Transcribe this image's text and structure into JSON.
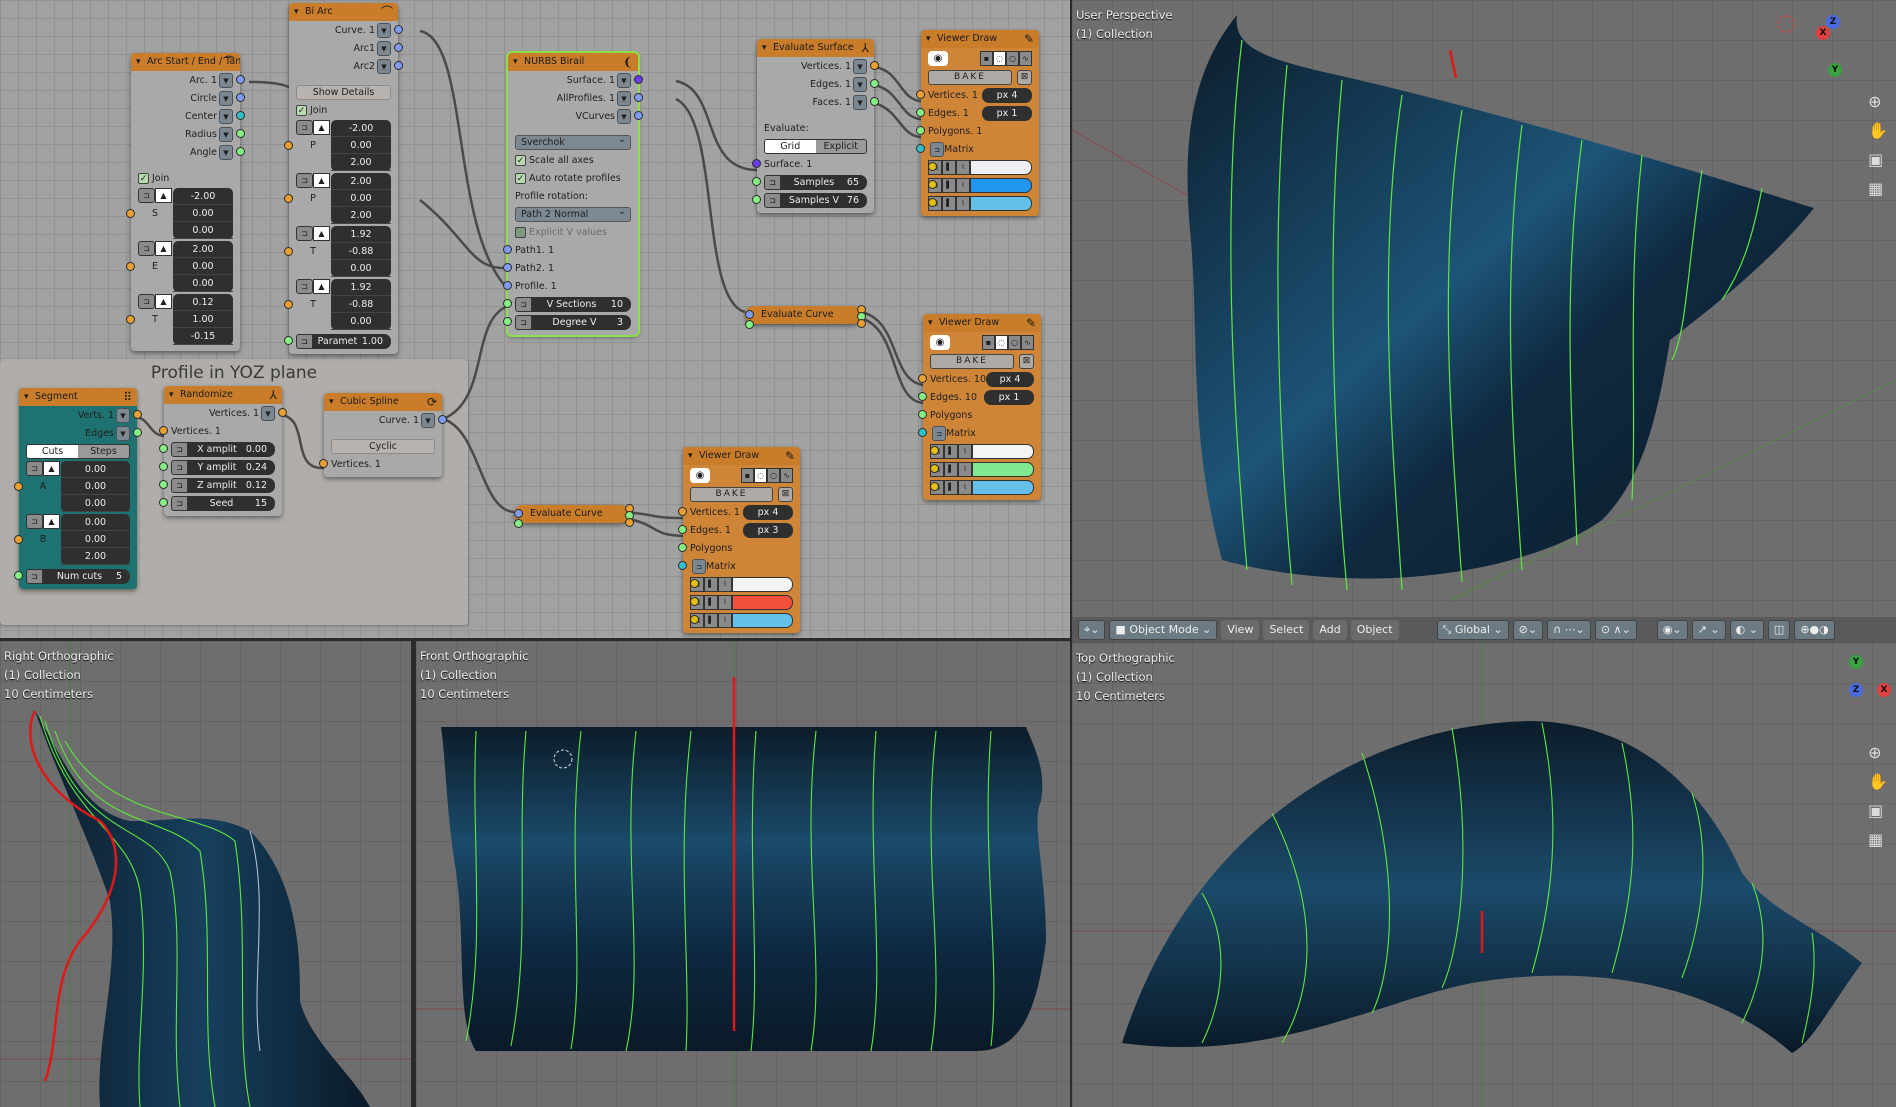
{
  "socket_colors": {
    "vertices": "#e8a030",
    "number": "#86f086",
    "curve": "#7f9cf0",
    "matrix": "#30c0c8",
    "surface": "#6a3cf0",
    "color": "#e0c010"
  },
  "node_editor": {
    "frame_label": "Profile in YOZ plane",
    "nodes": [
      {
        "id": "arc",
        "title": "Arc Start / End / Tan.",
        "icon": "arc-icon",
        "style": "",
        "rows": [
          {
            "t": "out",
            "label": "Arc. 1",
            "sock": "curve"
          },
          {
            "t": "out",
            "label": "Circle",
            "sock": "curve"
          },
          {
            "t": "out",
            "label": "Center",
            "sock": "matrix"
          },
          {
            "t": "out",
            "label": "Radius",
            "sock": "number"
          },
          {
            "t": "out",
            "label": "Angle",
            "sock": "number"
          },
          {
            "t": "gap"
          },
          {
            "t": "check",
            "label": "Join",
            "checked": true
          },
          {
            "t": "vec",
            "label": "S",
            "values": [
              "-2.00",
              "0.00",
              "0.00"
            ]
          },
          {
            "t": "vec",
            "label": "E",
            "values": [
              "2.00",
              "0.00",
              "0.00"
            ]
          },
          {
            "t": "vec",
            "label": "T",
            "values": [
              "0.12",
              "1.00",
              "-0.15"
            ]
          }
        ]
      },
      {
        "id": "biarc",
        "title": "Bi Arc",
        "icon": "arc-icon",
        "style": "",
        "rows": [
          {
            "t": "out",
            "label": "Curve. 1",
            "sock": "curve"
          },
          {
            "t": "out",
            "label": "Arc1",
            "sock": "curve"
          },
          {
            "t": "out",
            "label": "Arc2",
            "sock": "curve"
          },
          {
            "t": "gap"
          },
          {
            "t": "button",
            "label": "Show Details"
          },
          {
            "t": "check",
            "label": "Join",
            "checked": true
          },
          {
            "t": "vec",
            "label": "P",
            "values": [
              "-2.00",
              "0.00",
              "2.00"
            ]
          },
          {
            "t": "vec",
            "label": "P",
            "values": [
              "2.00",
              "0.00",
              "2.00"
            ]
          },
          {
            "t": "vec",
            "label": "T",
            "values": [
              "1.92",
              "-0.88",
              "0.00"
            ]
          },
          {
            "t": "vec",
            "label": "T",
            "values": [
              "1.92",
              "-0.88",
              "0.00"
            ]
          },
          {
            "t": "infield",
            "label": "Paramet",
            "value": "1.00",
            "sock": "number"
          }
        ]
      },
      {
        "id": "nurbs",
        "title": "NURBS Birail",
        "icon": "birail-icon",
        "style": "sel",
        "rows": [
          {
            "t": "out",
            "label": "Surface. 1",
            "sock": "surface"
          },
          {
            "t": "out",
            "label": "AllProfiles. 1",
            "sock": "curve"
          },
          {
            "t": "out",
            "label": "VCurves",
            "sock": "curve"
          },
          {
            "t": "gap"
          },
          {
            "t": "select",
            "value": "Sverchok"
          },
          {
            "t": "check",
            "label": "Scale all axes",
            "checked": true
          },
          {
            "t": "check",
            "label": "Auto rotate profiles",
            "checked": true
          },
          {
            "t": "text",
            "label": "Profile rotation:"
          },
          {
            "t": "select",
            "value": "Path 2 Normal"
          },
          {
            "t": "check",
            "label": "Explicit V values",
            "checked": false
          },
          {
            "t": "in",
            "label": "Path1. 1",
            "sock": "curve"
          },
          {
            "t": "in",
            "label": "Path2. 1",
            "sock": "curve"
          },
          {
            "t": "in",
            "label": "Profile. 1",
            "sock": "curve"
          },
          {
            "t": "infield",
            "label": "V Sections",
            "value": "10",
            "sock": "number"
          },
          {
            "t": "infield",
            "label": "Degree V",
            "value": "3",
            "sock": "number"
          }
        ]
      },
      {
        "id": "evalsurf",
        "title": "Evaluate Surface",
        "icon": "surface-icon",
        "style": "",
        "rows": [
          {
            "t": "out",
            "label": "Vertices. 1",
            "sock": "vertices"
          },
          {
            "t": "out",
            "label": "Edges. 1",
            "sock": "number"
          },
          {
            "t": "out",
            "label": "Faces. 1",
            "sock": "number"
          },
          {
            "t": "gap"
          },
          {
            "t": "text",
            "label": "Evaluate:"
          },
          {
            "t": "toggle",
            "options": [
              "Grid",
              "Explicit"
            ],
            "active": 0
          },
          {
            "t": "in",
            "label": "Surface. 1",
            "sock": "surface"
          },
          {
            "t": "infield",
            "label": "Samples",
            "value": "65",
            "sock": "number"
          },
          {
            "t": "infield",
            "label": "Samples V",
            "value": "76",
            "sock": "number"
          }
        ]
      },
      {
        "id": "vd1",
        "title": "Viewer Draw",
        "icon": "pencil-icon",
        "style": "orange",
        "rows": [
          {
            "t": "vdicons"
          },
          {
            "t": "bake",
            "label": "BAKE"
          },
          {
            "t": "invd",
            "label": "Vertices. 1",
            "px": "px  4",
            "sock": "vertices"
          },
          {
            "t": "invd",
            "label": "Edges. 1",
            "px": "px  1",
            "sock": "number"
          },
          {
            "t": "invd",
            "label": "Polygons. 1",
            "sock": "number"
          },
          {
            "t": "matrix",
            "label": "Matrix"
          },
          {
            "t": "color",
            "color": "#f0f0f4"
          },
          {
            "t": "color",
            "color": "#2196f0"
          },
          {
            "t": "color",
            "color": "#64c0e8"
          }
        ]
      },
      {
        "id": "ec1",
        "title": "Evaluate Curve",
        "style": "collapsed",
        "rows": []
      },
      {
        "id": "vd2",
        "title": "Viewer Draw",
        "icon": "pencil-icon",
        "style": "orange",
        "rows": [
          {
            "t": "vdicons"
          },
          {
            "t": "bake",
            "label": "BAKE"
          },
          {
            "t": "invd",
            "label": "Vertices. 10",
            "px": "px  4",
            "sock": "vertices"
          },
          {
            "t": "invd",
            "label": "Edges. 10",
            "px": "px  1",
            "sock": "number"
          },
          {
            "t": "invd",
            "label": "Polygons",
            "sock": "number"
          },
          {
            "t": "matrix",
            "label": "Matrix"
          },
          {
            "t": "color",
            "color": "#f4f4f4"
          },
          {
            "t": "color",
            "color": "#80e890"
          },
          {
            "t": "color",
            "color": "#64c0e8"
          }
        ]
      },
      {
        "id": "segment",
        "title": "Segment",
        "icon": "grip-icon",
        "style": "teal",
        "rows": [
          {
            "t": "out",
            "label": "Verts. 1",
            "sock": "vertices"
          },
          {
            "t": "out",
            "label": "Edges",
            "sock": "number"
          },
          {
            "t": "toggle",
            "options": [
              "Cuts",
              "Steps"
            ],
            "active": 0
          },
          {
            "t": "vec",
            "label": "A",
            "values": [
              "0.00",
              "0.00",
              "0.00"
            ]
          },
          {
            "t": "vec",
            "label": "B",
            "values": [
              "0.00",
              "0.00",
              "2.00"
            ]
          },
          {
            "t": "infield",
            "label": "Num cuts",
            "value": "5",
            "sock": "number"
          }
        ]
      },
      {
        "id": "randomize",
        "title": "Randomize",
        "icon": "surface-icon",
        "style": "",
        "rows": [
          {
            "t": "out",
            "label": "Vertices. 1",
            "sock": "vertices"
          },
          {
            "t": "in",
            "label": "Vertices. 1",
            "sock": "vertices"
          },
          {
            "t": "infield",
            "label": "X amplit",
            "value": "0.00",
            "sock": "number"
          },
          {
            "t": "infield",
            "label": "Y amplit",
            "value": "0.24",
            "sock": "number"
          },
          {
            "t": "infield",
            "label": "Z amplit",
            "value": "0.12",
            "sock": "number"
          },
          {
            "t": "infield",
            "label": "Seed",
            "value": "15",
            "sock": "number"
          }
        ]
      },
      {
        "id": "cubic",
        "title": "Cubic Spline",
        "icon": "spline-icon",
        "style": "",
        "rows": [
          {
            "t": "out",
            "label": "Curve. 1",
            "sock": "curve"
          },
          {
            "t": "gap"
          },
          {
            "t": "button",
            "label": "Cyclic"
          },
          {
            "t": "in",
            "label": "Vertices. 1",
            "sock": "vertices"
          }
        ]
      },
      {
        "id": "ec2",
        "title": "Evaluate Curve",
        "style": "collapsed",
        "rows": []
      },
      {
        "id": "vd3",
        "title": "Viewer Draw",
        "icon": "pencil-icon",
        "style": "orange",
        "rows": [
          {
            "t": "vdicons"
          },
          {
            "t": "bake",
            "label": "BAKE"
          },
          {
            "t": "invd",
            "label": "Vertices. 1",
            "px": "px  4",
            "sock": "vertices"
          },
          {
            "t": "invd",
            "label": "Edges. 1",
            "px": "px  3",
            "sock": "number"
          },
          {
            "t": "invd",
            "label": "Polygons",
            "sock": "number"
          },
          {
            "t": "matrix",
            "label": "Matrix"
          },
          {
            "t": "color",
            "color": "#f4f4f4"
          },
          {
            "t": "color",
            "color": "#f0503c"
          },
          {
            "t": "color",
            "color": "#64c0e8"
          }
        ]
      }
    ]
  },
  "viewports": {
    "perspective": {
      "view": "User Perspective",
      "collection": "(1) Collection"
    },
    "right": {
      "view": "Right Orthographic",
      "collection": "(1) Collection",
      "scale": "10 Centimeters"
    },
    "front": {
      "view": "Front Orthographic",
      "collection": "(1) Collection",
      "scale": "10 Centimeters"
    },
    "top": {
      "view": "Top Orthographic",
      "collection": "(1) Collection",
      "scale": "10 Centimeters"
    },
    "gizmo": {
      "x": "X",
      "y": "Y",
      "z": "Z"
    }
  },
  "viewport_header": {
    "mode": "Object Mode",
    "menus": [
      "View",
      "Select",
      "Add",
      "Object"
    ],
    "orientation": "Global"
  },
  "colors": {
    "surface": "#0e2233",
    "surface_lines": "#5ee83c",
    "axis_red": "#e01818"
  }
}
